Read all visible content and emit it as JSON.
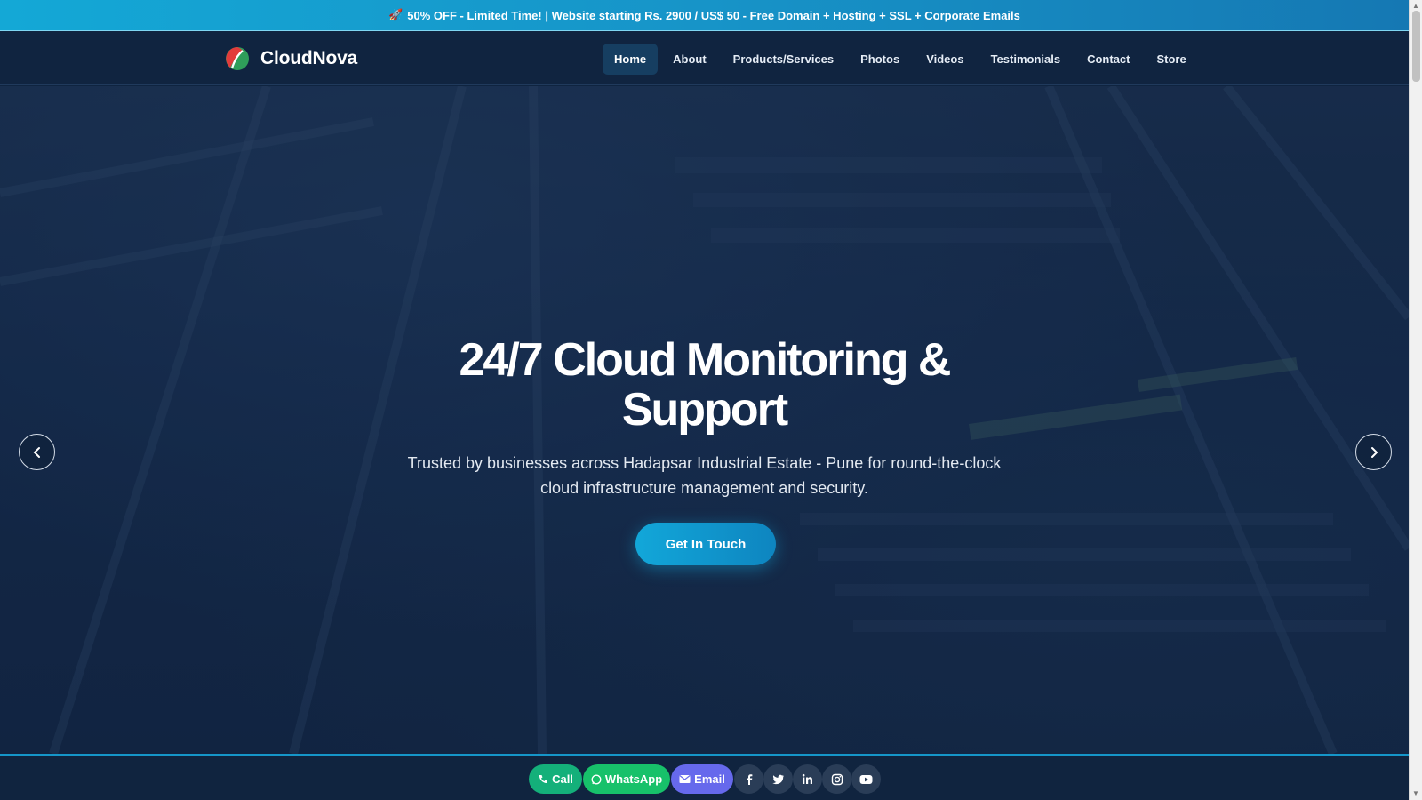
{
  "promo": {
    "icon": "rocket-icon",
    "text": "50% OFF - Limited Time! | Website starting Rs. 2900 / US$ 50 - Free Domain + Hosting + SSL + Corporate Emails"
  },
  "brand": {
    "name": "CloudNova",
    "logo": "cloudnova-logo",
    "logo_colors": [
      "#e23b3b",
      "#2f9e5a"
    ]
  },
  "nav": {
    "items": [
      {
        "label": "Home",
        "active": true
      },
      {
        "label": "About"
      },
      {
        "label": "Products/Services"
      },
      {
        "label": "Photos"
      },
      {
        "label": "Videos"
      },
      {
        "label": "Testimonials"
      },
      {
        "label": "Contact"
      },
      {
        "label": "Store"
      }
    ]
  },
  "hero": {
    "title_line1": "24/7 Cloud Monitoring &",
    "title_line2": "Support",
    "subtitle": "Trusted by businesses across Hadapsar Industrial Estate - Pune for round-the-clock cloud infrastructure management and security.",
    "cta_label": "Get In Touch",
    "prev_icon": "chevron-left-icon",
    "next_icon": "chevron-right-icon"
  },
  "contact_bar": {
    "call_label": "Call",
    "whatsapp_label": "WhatsApp",
    "email_label": "Email",
    "social": [
      "facebook-icon",
      "twitter-icon",
      "linkedin-icon",
      "instagram-icon",
      "youtube-icon"
    ]
  },
  "colors": {
    "accent": "#12a7d9",
    "nav_bg": "#102440",
    "call": "#14b07a",
    "whatsapp": "#17c16a",
    "email": "#6669ec"
  }
}
